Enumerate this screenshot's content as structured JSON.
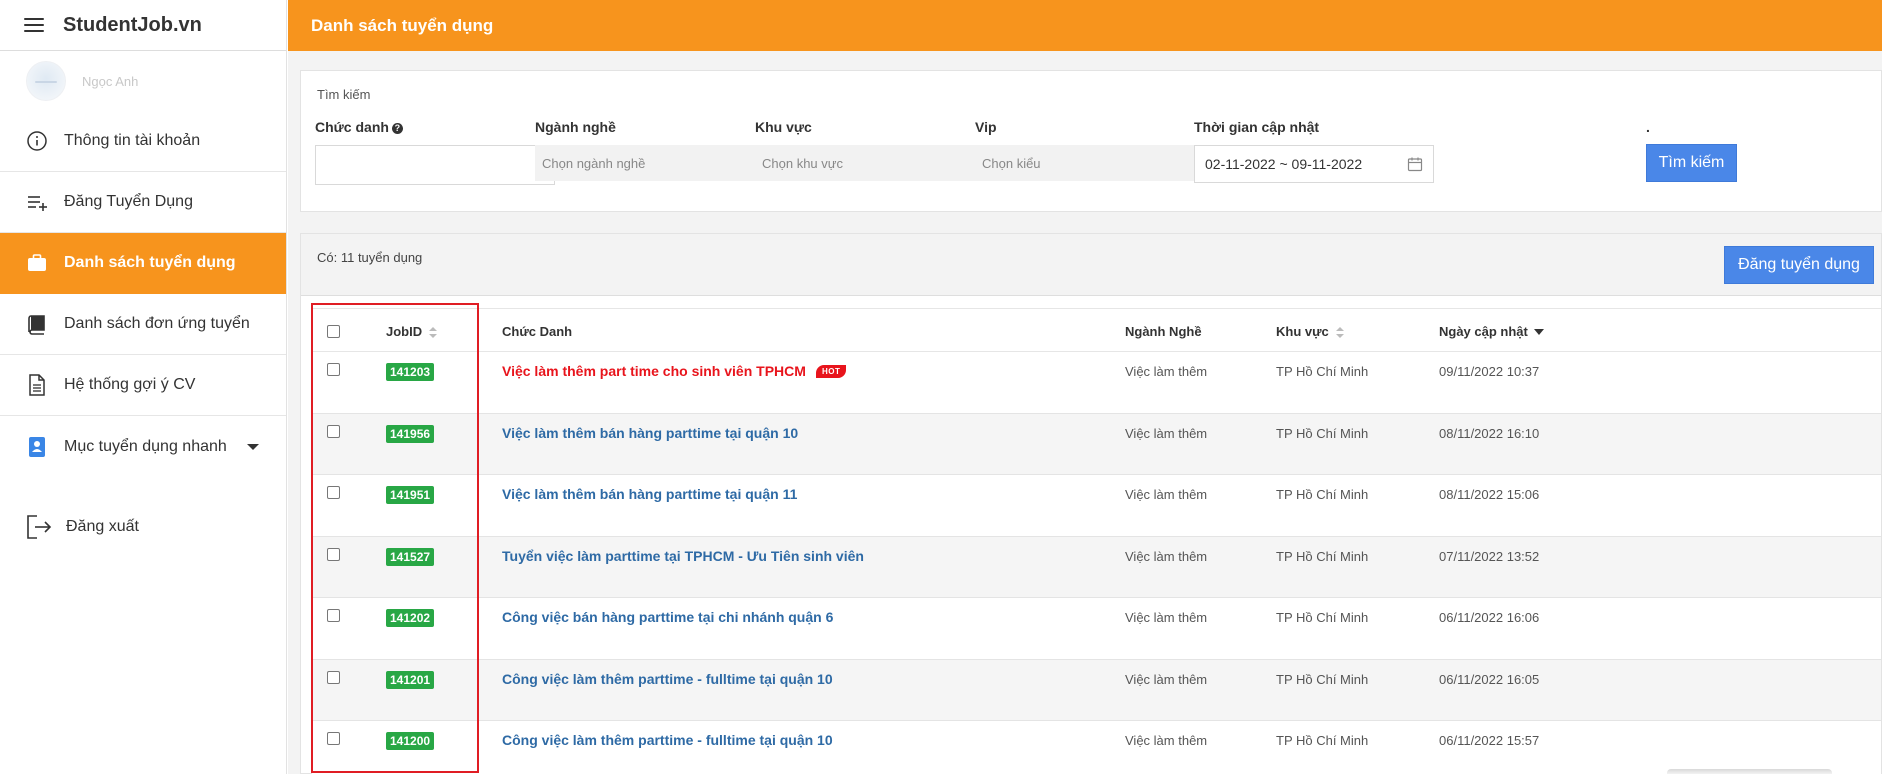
{
  "app": {
    "brand": "StudentJob.vn",
    "user_name": "Ngọc Anh"
  },
  "sidebar": {
    "items": [
      {
        "label": "Thông tin tài khoản",
        "icon": "info-icon"
      },
      {
        "label": "Đăng Tuyển Dụng",
        "icon": "list-add-icon"
      },
      {
        "label": "Danh sách tuyển dụng",
        "icon": "briefcase-icon",
        "active": true
      },
      {
        "label": "Danh sách đơn ứng tuyển",
        "icon": "book-icon"
      },
      {
        "label": "Hệ thống gợi ý CV",
        "icon": "document-icon"
      },
      {
        "label": "Mục tuyển dụng nhanh",
        "icon": "contact-book-icon",
        "has_dropdown": true
      }
    ],
    "logout_label": "Đăng xuất"
  },
  "header": {
    "title": "Danh sách tuyển dụng"
  },
  "search": {
    "legend": "Tìm kiếm",
    "title_label": "Chức danh",
    "title_value": "",
    "industry_label": "Ngành nghề",
    "industry_value": "Chọn ngành nghề",
    "region_label": "Khu vực",
    "region_value": "Chọn khu vực",
    "vip_label": "Vip",
    "vip_value": "Chọn kiểu",
    "date_label": "Thời gian cập nhật",
    "date_value": "02-11-2022 ~ 09-11-2022",
    "dot_label": ".",
    "button_label": "Tìm kiếm"
  },
  "list": {
    "count_text": "Có: 11 tuyển dụng",
    "post_button": "Đăng tuyển dụng",
    "columns": {
      "jobid": "JobID",
      "title": "Chức Danh",
      "industry": "Ngành Nghề",
      "region": "Khu vực",
      "updated": "Ngày cập nhật"
    },
    "hot_badge": "HOT",
    "rows": [
      {
        "id": "141203",
        "title": "Việc làm thêm part time cho sinh viên TPHCM",
        "hot": true,
        "industry": "Việc làm thêm",
        "region": "TP Hồ Chí Minh",
        "updated": "09/11/2022 10:37"
      },
      {
        "id": "141956",
        "title": "Việc làm thêm bán hàng parttime tại quận 10",
        "hot": false,
        "industry": "Việc làm thêm",
        "region": "TP Hồ Chí Minh",
        "updated": "08/11/2022 16:10"
      },
      {
        "id": "141951",
        "title": "Việc làm thêm bán hàng parttime tại quận 11",
        "hot": false,
        "industry": "Việc làm thêm",
        "region": "TP Hồ Chí Minh",
        "updated": "08/11/2022 15:06"
      },
      {
        "id": "141527",
        "title": "Tuyển việc làm parttime tại TPHCM - Ưu Tiên sinh viên",
        "hot": false,
        "industry": "Việc làm thêm",
        "region": "TP Hồ Chí Minh",
        "updated": "07/11/2022 13:52"
      },
      {
        "id": "141202",
        "title": "Công việc bán hàng parttime tại chi nhánh quận 6",
        "hot": false,
        "industry": "Việc làm thêm",
        "region": "TP Hồ Chí Minh",
        "updated": "06/11/2022 16:06"
      },
      {
        "id": "141201",
        "title": "Công việc làm thêm parttime - fulltime tại quận 10",
        "hot": false,
        "industry": "Việc làm thêm",
        "region": "TP Hồ Chí Minh",
        "updated": "06/11/2022 16:05"
      },
      {
        "id": "141200",
        "title": "Công việc làm thêm parttime - fulltime tại quận 10",
        "hot": false,
        "industry": "Việc làm thêm",
        "region": "TP Hồ Chí Minh",
        "updated": "06/11/2022 15:57"
      }
    ]
  },
  "colors": {
    "accent": "#f7941d",
    "primary_button": "#4a87e8",
    "jobid_badge": "#28a745",
    "hot": "#e8141c",
    "link": "#2e6aa5",
    "highlight_box": "#e01d24"
  }
}
